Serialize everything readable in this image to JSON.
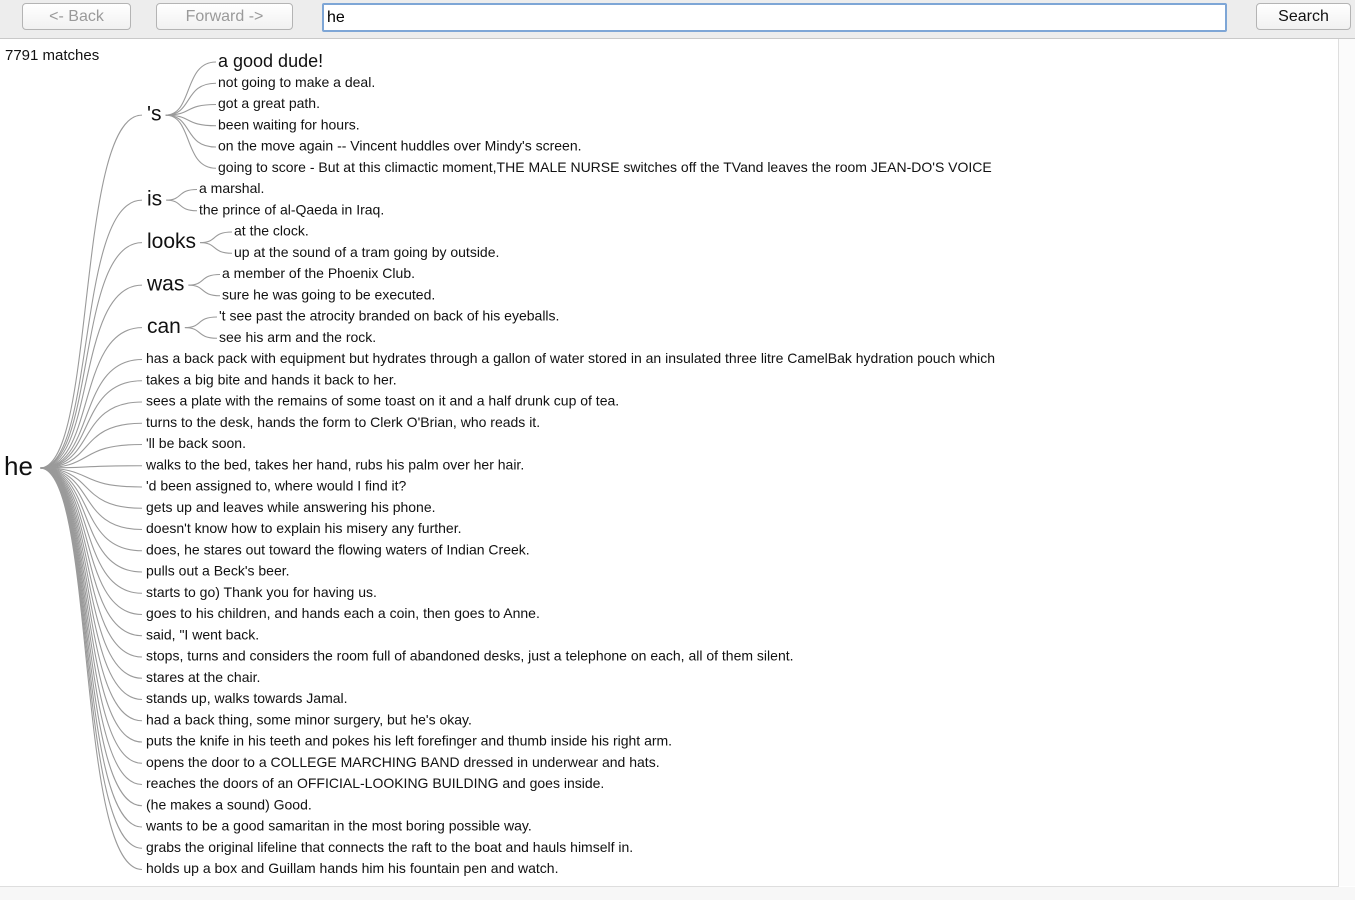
{
  "nav": {
    "back_label": "<- Back",
    "forward_label": "Forward ->",
    "search_label": "Search"
  },
  "search": {
    "value": "he"
  },
  "results": {
    "count_text": "7791 matches"
  },
  "tree": {
    "root": "he",
    "branches": [
      {
        "word": "'s",
        "leaves": [
          "a good dude!",
          "not going to make a deal.",
          "got a great path.",
          "been waiting      for hours.",
          "on the move again --  Vincent huddles over Mindy's screen.",
          "going to score -  But at this climactic moment,THE MALE NURSE switches off the TVand leaves the room                              JEAN-DO'S VOICE"
        ]
      },
      {
        "word": "is",
        "leaves": [
          "a                   marshal.",
          "the              prince of al-Qaeda in Iraq."
        ]
      },
      {
        "word": "looks",
        "leaves": [
          "at the clock.",
          "up at the sound of a tram going by outside."
        ]
      },
      {
        "word": "was",
        "leaves": [
          "a member of the Phoenix Club.",
          "     sure he was going to be executed."
        ]
      },
      {
        "word": "can",
        "leaves": [
          "'t see past the      atrocity branded on back of his eyeballs.",
          "see his arm and the rock."
        ]
      }
    ],
    "continuations": [
      "has a          back pack with equipment but hydrates through a gallon of          water stored in an insulated three litre CamelBak hydration          pouch which",
      "takes a big bite and hands it back to her.",
      "sees a       plate with the remains of some toast on it and a half drunk       cup of tea.",
      "turns to the desk, hands the form to      Clerk O'Brian, who reads it.",
      "'ll be back soon.",
      "walks to the bed, takes her hand, rubs his palm over her     hair.",
      "'d been              assigned to, where would I find it?",
      "gets up and leaves while answering his phone.",
      "doesn't know how to explain his misery any further.",
      "does, he stares out toward the flowing     waters of Indian Creek.",
      "pulls out a Beck's beer.",
      "starts to go)                  Thank you for having us.",
      "goes to his children, and     hands each a coin, then goes to Anne.",
      "said, \"I went back.",
      "stops, turns and considers the room full of abandoned      desks, just a telephone on each, all of them silent.",
      "stares at the chair.",
      "stands up,       walks towards Jamal.",
      "had a back thing, some minor surgery,           but he's okay.",
      "puts the knife in          his teeth and pokes his left forefinger and thumb inside his          right arm.",
      "opens the door to a        COLLEGE MARCHING BAND        dressed in underwear and hats.",
      "reaches the      doors of an OFFICIAL-LOOKING BUILDING and goes inside.",
      "     (he makes a sound)          Good.",
      "wants to be a              good samaritan in the most boring              possible way.",
      "grabs the      original lifeline that connects the raft to the boat and      hauls himself in.",
      "holds up a box and Guillam hands him his fountain pen and watch."
    ]
  }
}
